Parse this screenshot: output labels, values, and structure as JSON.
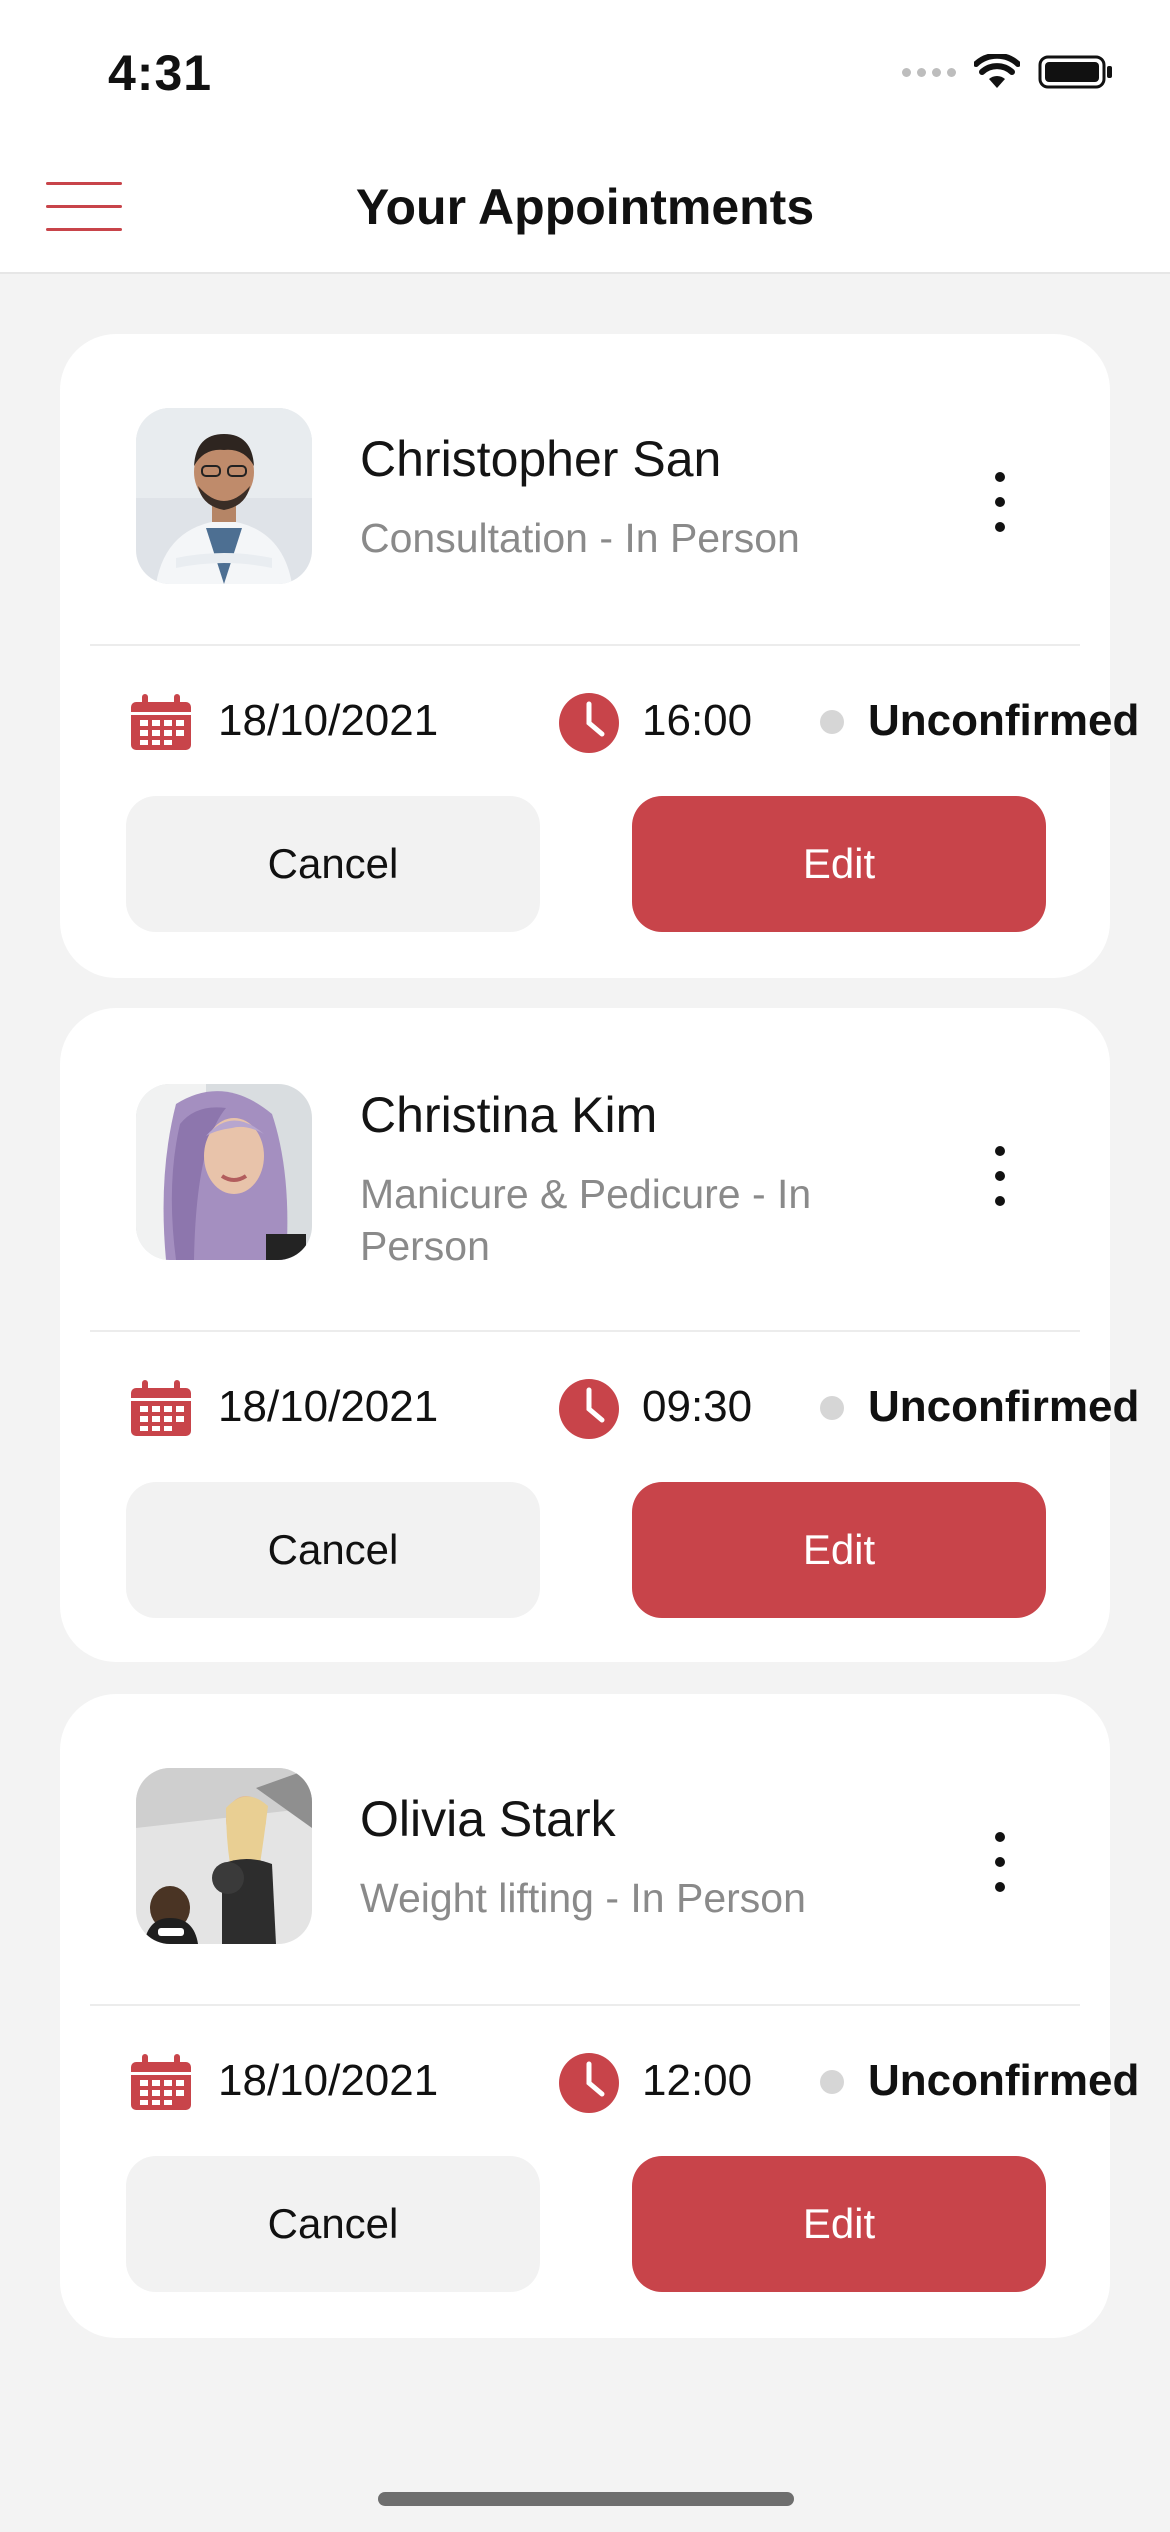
{
  "status_bar": {
    "time": "4:31"
  },
  "header": {
    "title": "Your Appointments",
    "menu_icon": "hamburger-menu-icon"
  },
  "colors": {
    "accent": "#c8444a",
    "status_unconfirmed": "#d6d6d6",
    "background": "#f3f3f3"
  },
  "appointments": [
    {
      "name": "Christopher San",
      "service": "Consultation - In Person",
      "date": "18/10/2021",
      "time": "16:00",
      "status": "Unconfirmed",
      "cancel_label": "Cancel",
      "edit_label": "Edit"
    },
    {
      "name": "Christina Kim",
      "service": "Manicure & Pedicure - In Person",
      "date": "18/10/2021",
      "time": "09:30",
      "status": "Unconfirmed",
      "cancel_label": "Cancel",
      "edit_label": "Edit"
    },
    {
      "name": "Olivia Stark",
      "service": "Weight lifting - In Person",
      "date": "18/10/2021",
      "time": "12:00",
      "status": "Unconfirmed",
      "cancel_label": "Cancel",
      "edit_label": "Edit"
    }
  ]
}
